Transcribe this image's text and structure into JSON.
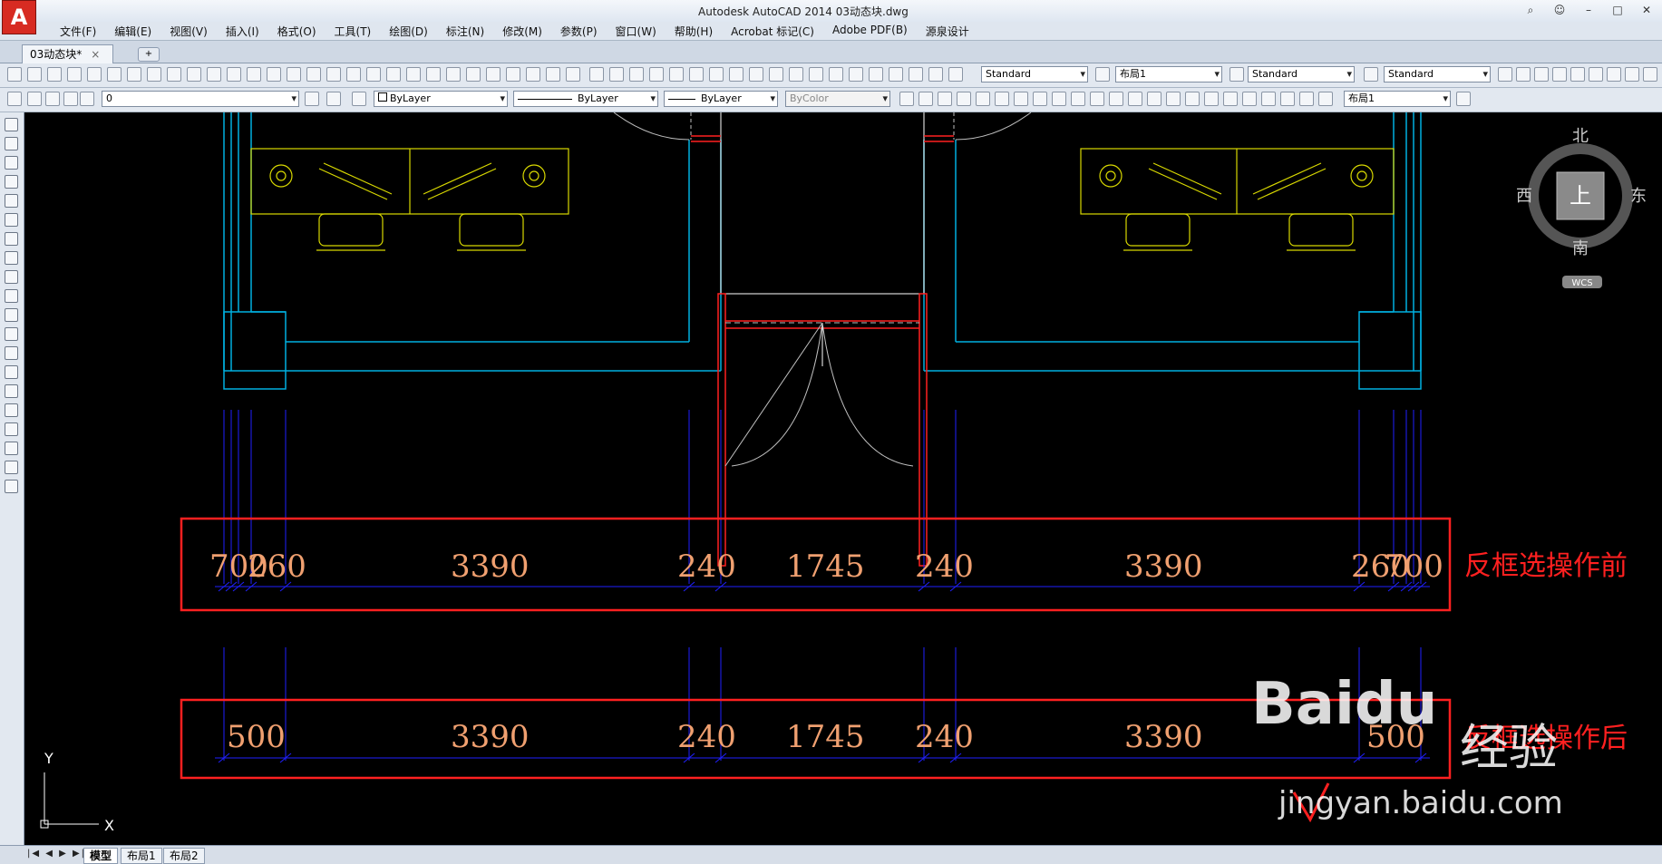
{
  "window": {
    "title": "Autodesk AutoCAD 2014    03动态块.dwg",
    "app_logo": "A"
  },
  "menu": {
    "items": [
      "文件(F)",
      "编辑(E)",
      "视图(V)",
      "插入(I)",
      "格式(O)",
      "工具(T)",
      "绘图(D)",
      "标注(N)",
      "修改(M)",
      "参数(P)",
      "窗口(W)",
      "帮助(H)",
      "Acrobat 标记(C)",
      "Adobe PDF(B)",
      "源泉设计"
    ]
  },
  "tabs": {
    "document": "03动态块*",
    "close": "×",
    "new": "+"
  },
  "toolbar1": {
    "text_style": "Standard",
    "layout": "布局1",
    "table_style": "Standard",
    "mleader_style": "Standard"
  },
  "toolbar2": {
    "layer": "0",
    "color": "ByLayer",
    "linetype": "ByLayer",
    "lineweight": "ByLayer",
    "plot_style": "ByColor",
    "layout2": "布局1"
  },
  "viewcube": {
    "north": "北",
    "south": "南",
    "east": "东",
    "west": "西",
    "face": "上",
    "wcs": "WCS"
  },
  "ucs": {
    "x": "X",
    "y": "Y"
  },
  "dims_before": {
    "overlap_left": "700",
    "left_small": "260",
    "a": "3390",
    "b": "240",
    "c": "1745",
    "d": "240",
    "e": "3390",
    "right_small": "260",
    "overlap_right": "700",
    "caption": "反框选操作前"
  },
  "dims_after": {
    "left": "500",
    "a": "3390",
    "b": "240",
    "c": "1745",
    "d": "240",
    "e": "3390",
    "right": "500",
    "caption": "反框选操作后"
  },
  "status": {
    "nav": "|◀ ◀ ▶ ▶|",
    "model": "模型",
    "layout1": "布局1",
    "layout2": "布局2"
  },
  "watermark": {
    "brand": "Baidu",
    "cn": "经验",
    "url": "jingyan.baidu.com"
  },
  "colors": {
    "wall": "#00b0e0",
    "furniture": "#d8d800",
    "door": "#c0c0c0",
    "red": "#ff2020",
    "dim_line": "#2020ff",
    "dim_text": "#f0a070",
    "frame": "#ff2020"
  }
}
